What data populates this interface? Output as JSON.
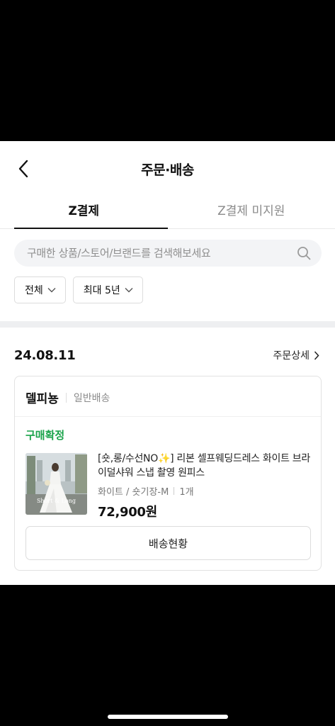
{
  "header": {
    "title": "주문·배송",
    "back_icon": "chevron-left-icon"
  },
  "tabs": [
    {
      "label": "Z결제",
      "active": true
    },
    {
      "label": "Z결제 미지원",
      "active": false
    }
  ],
  "search": {
    "placeholder": "구매한 상품/스토어/브랜드를 검색해보세요",
    "icon": "search-icon"
  },
  "filters": [
    {
      "label": "전체",
      "icon": "chevron-down-icon"
    },
    {
      "label": "최대 5년",
      "icon": "chevron-down-icon"
    }
  ],
  "order": {
    "date": "24.08.11",
    "detail_label": "주문상세",
    "seller": "델피뇽",
    "shipping_type": "일반배송",
    "status": "구매확정",
    "status_color": "#1aa34a",
    "product": {
      "name": "[숏,롱/수선NO✨] 리본 셀프웨딩드레스 화이트 브라이덜샤워 스냅 촬영 원피스",
      "option": "화이트 / 숏기장-M",
      "quantity": "1개",
      "price": "72,900원",
      "image_text": "Short & Long"
    },
    "track_button": "배송현황"
  }
}
